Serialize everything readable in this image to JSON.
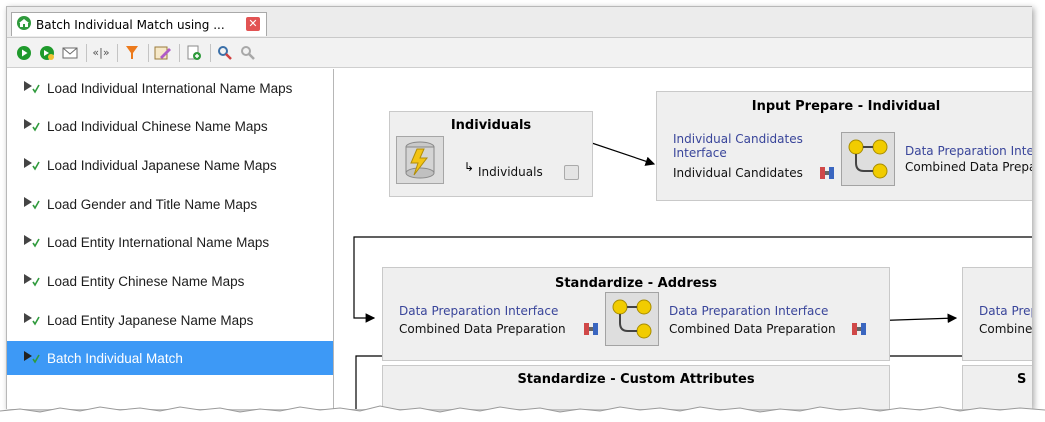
{
  "tab": {
    "title": "Batch Individual Match using ...",
    "close_icon": "close-icon"
  },
  "toolbar": {
    "icons": [
      "run-icon",
      "run-from-icon",
      "message-icon",
      "code-icon",
      "filter-icon",
      "edit-icon",
      "add-icon",
      "find-icon",
      "find-next-icon"
    ]
  },
  "sidebar": {
    "items": [
      {
        "label": "Load Individual International Name Maps"
      },
      {
        "label": "Load Individual Chinese Name Maps"
      },
      {
        "label": "Load Individual Japanese Name Maps"
      },
      {
        "label": "Load Gender and Title Name Maps"
      },
      {
        "label": "Load Entity International Name Maps"
      },
      {
        "label": "Load Entity Chinese Name Maps"
      },
      {
        "label": "Load Entity Japanese Name Maps"
      },
      {
        "label": "Batch Individual Match",
        "selected": true
      }
    ]
  },
  "canvas": {
    "individuals": {
      "title": "Individuals",
      "output": "Individuals"
    },
    "input_prepare": {
      "title": "Input Prepare - Individual",
      "input_link": "Individual Candidates Interface",
      "input_sub": "Individual Candidates",
      "output_link": "Data Preparation Inte",
      "output_sub": "Combined Data Prepar"
    },
    "standardize_address": {
      "title": "Standardize - Address",
      "input_link": "Data Preparation Interface",
      "input_sub": "Combined Data Preparation",
      "output_link": "Data Preparation Interface",
      "output_sub": "Combined Data Preparation"
    },
    "right_partial": {
      "link": "Data Prep",
      "sub": "Combined"
    },
    "standardize_custom": {
      "title": "Standardize - Custom Attributes"
    },
    "right_partial_bottom": {
      "title": "S"
    }
  },
  "colors": {
    "selected": "#3d99f6",
    "link": "#39459a",
    "box": "#efefef"
  }
}
